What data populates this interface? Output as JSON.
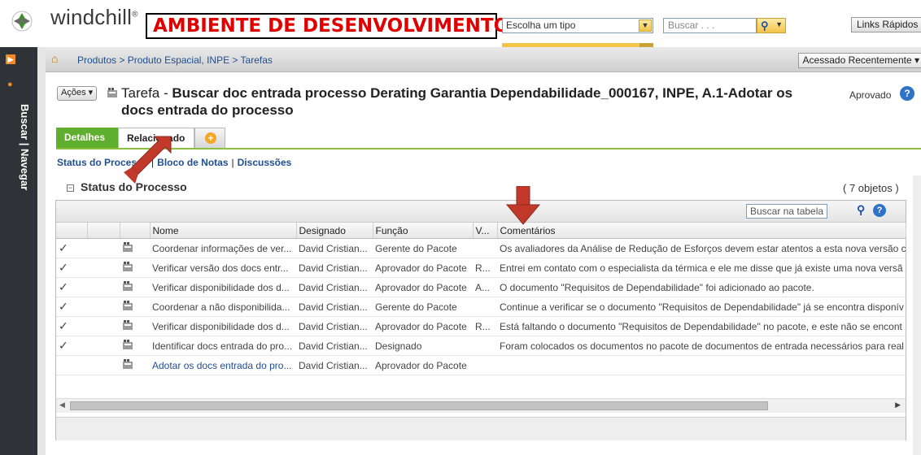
{
  "header": {
    "brand": "windchill",
    "environment_banner": "AMBIENTE DE DESENVOLVIMENTO",
    "type_select": {
      "value": "Escolha um tipo"
    },
    "search": {
      "placeholder": "Buscar . . ."
    },
    "quick_links": "Links Rápidos"
  },
  "sidebar": {
    "vertical_label": "Buscar | Navegar"
  },
  "breadcrumb": {
    "path": "Produtos > Produto Espacial, INPE > Tarefas",
    "recent": "Acessado Recentemente"
  },
  "page": {
    "actions_label": "Ações",
    "title_prefix": "Tarefa - ",
    "title": "Buscar doc entrada processo Derating Garantia Dependabilidade_000167, INPE, A.1-Adotar os docs entrada do processo",
    "status": "Aprovado"
  },
  "tabs": {
    "details": "Detalhes",
    "related": "Relacionado"
  },
  "sublinks": {
    "status": "Status do Processo",
    "notes": "Bloco de Notas",
    "discussions": "Discussões"
  },
  "section": {
    "title": "Status do Processo",
    "count": "( 7 objetos )"
  },
  "table": {
    "search_placeholder": "Buscar na tabela",
    "headers": {
      "name": "Nome",
      "assigned": "Designado",
      "role": "Função",
      "v": "V...",
      "comments": "Comentários"
    },
    "rows": [
      {
        "check": "✓",
        "name": "Coordenar informações de ver...",
        "assigned": "David Cristian...",
        "role": "Gerente do Pacote",
        "v": "",
        "comment": "Os avaliadores da Análise de Redução de Esforços devem estar atentos a esta nova versão c"
      },
      {
        "check": "✓",
        "name": "Verificar versão dos docs entr...",
        "assigned": "David Cristian...",
        "role": "Aprovador do Pacote",
        "v": "R...",
        "comment": "Entrei em contato com o especialista da térmica e ele me disse que já existe uma nova versã"
      },
      {
        "check": "✓",
        "name": "Verificar disponibilidade dos d...",
        "assigned": "David Cristian...",
        "role": "Aprovador do Pacote",
        "v": "A...",
        "comment": "O documento \"Requisitos de Dependabilidade\" foi adicionado ao pacote."
      },
      {
        "check": "✓",
        "name": "Coordenar a não disponibilida...",
        "assigned": "David Cristian...",
        "role": "Gerente do Pacote",
        "v": "",
        "comment": "Continue a verificar se o documento \"Requisitos de Dependabilidade\" já se encontra disponív"
      },
      {
        "check": "✓",
        "name": "Verificar disponibilidade dos d...",
        "assigned": "David Cristian...",
        "role": "Aprovador do Pacote",
        "v": "R...",
        "comment": "Está faltando o documento \"Requisitos de Dependabilidade\" no pacote, e este não se encont"
      },
      {
        "check": "✓",
        "name": "Identificar docs entrada do pro...",
        "assigned": "David Cristian...",
        "role": "Designado",
        "v": "",
        "comment": "Foram colocados os documentos no pacote de documentos de entrada necessários para real"
      },
      {
        "check": "",
        "name": "Adotar os docs entrada do pro...",
        "assigned": "David Cristian...",
        "role": "Aprovador do Pacote",
        "v": "",
        "comment": ""
      }
    ]
  },
  "colors": {
    "banner_red": "#e00000",
    "tab_green": "#5fae2e",
    "link_blue": "#1f4e92",
    "arrow_red": "#c0392b",
    "sidebar_dark": "#2f3237"
  }
}
